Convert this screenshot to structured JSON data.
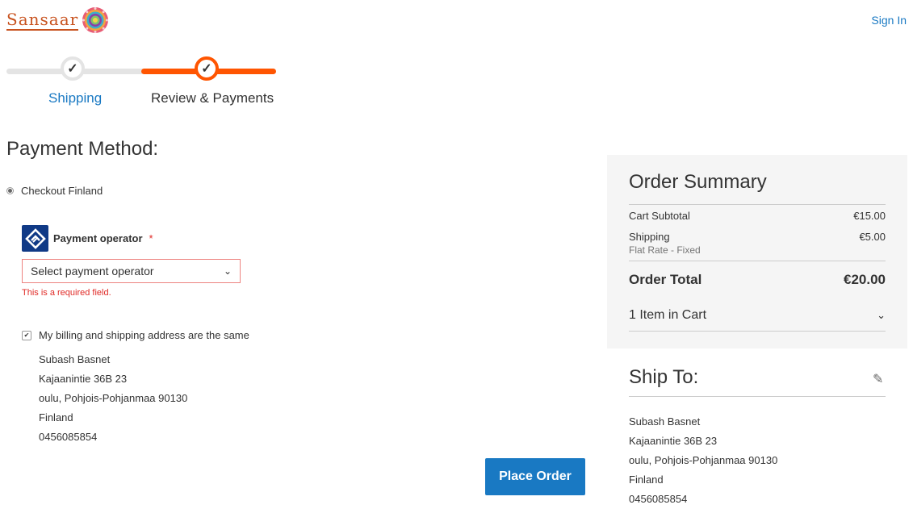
{
  "header": {
    "logo_text": "Sansaar",
    "signin_label": "Sign In"
  },
  "progress": {
    "steps": [
      {
        "label": "Shipping",
        "check": "✓"
      },
      {
        "label": "Review & Payments",
        "check": "✓"
      }
    ]
  },
  "payment": {
    "title": "Payment Method:",
    "method_label": "Checkout Finland",
    "operator_label": "Payment operator",
    "required_mark": "*",
    "select_value": "Select payment operator",
    "error": "This is a required field.",
    "billing_same_label": "My billing and shipping address are the same",
    "address": [
      "Subash Basnet",
      "Kajaanintie 36B 23",
      "oulu, Pohjois-Pohjanmaa 90130",
      "Finland",
      "0456085854"
    ],
    "place_order_label": "Place Order"
  },
  "summary": {
    "title": "Order Summary",
    "subtotal_label": "Cart Subtotal",
    "subtotal_value": "€15.00",
    "shipping_label": "Shipping",
    "shipping_method": "Flat Rate - Fixed",
    "shipping_value": "€5.00",
    "total_label": "Order Total",
    "total_value": "€20.00",
    "items_label": "1 Item in Cart"
  },
  "ship_to": {
    "title": "Ship To:",
    "address": [
      "Subash Basnet",
      "Kajaanintie 36B 23",
      "oulu, Pohjois-Pohjanmaa 90130",
      "Finland",
      "0456085854"
    ]
  },
  "colors": {
    "accent": "#1979c3",
    "progress": "#ff5501",
    "error": "#e02b27",
    "brand": "#c8531f"
  }
}
